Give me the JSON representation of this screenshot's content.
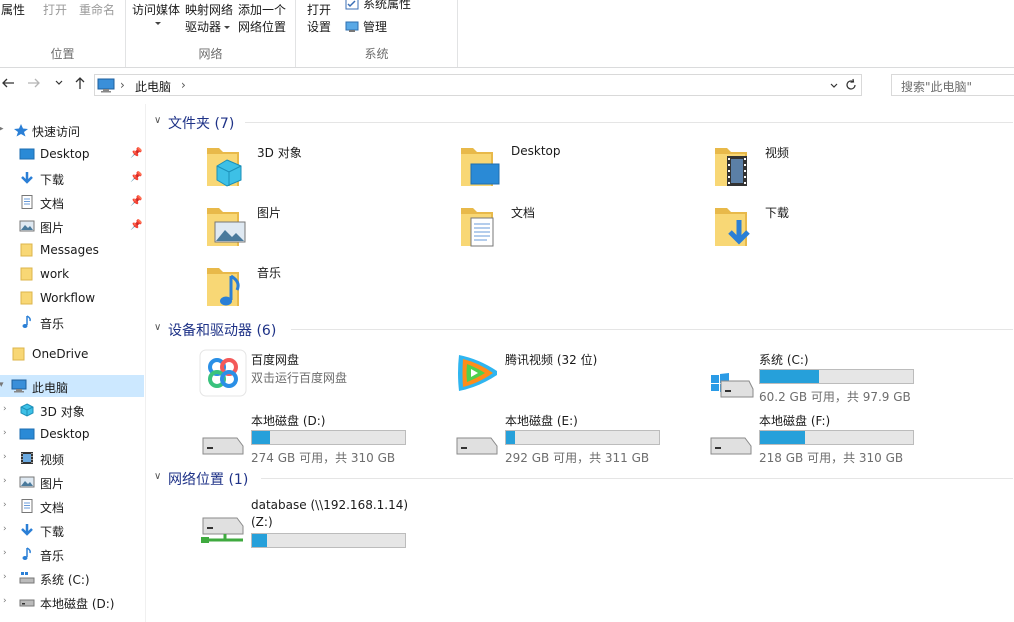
{
  "ribbon": {
    "groups": [
      {
        "label": "位置",
        "buttons": [
          "属性",
          "打开",
          "重命名"
        ]
      },
      {
        "label": "网络",
        "buttons": [
          "访问媒体",
          "映射网络",
          "驱动器",
          "添加一个",
          "网络位置"
        ]
      },
      {
        "label": "系统",
        "buttons": [
          "打开",
          "设置",
          "系统属性",
          "管理"
        ]
      }
    ]
  },
  "address": {
    "crumb": "此电脑",
    "search_placeholder": "搜索\"此电脑\""
  },
  "nav": {
    "quick_access": "快速访问",
    "items": [
      {
        "label": "Desktop",
        "icon": "desktop-icon",
        "pinned": true
      },
      {
        "label": "下载",
        "icon": "download-icon",
        "pinned": true
      },
      {
        "label": "文档",
        "icon": "document-icon",
        "pinned": true
      },
      {
        "label": "图片",
        "icon": "picture-icon",
        "pinned": true
      },
      {
        "label": "Messages",
        "icon": "folder-icon"
      },
      {
        "label": "work",
        "icon": "folder-icon"
      },
      {
        "label": "Workflow",
        "icon": "folder-icon"
      },
      {
        "label": "音乐",
        "icon": "music-icon"
      }
    ],
    "onedrive": "OneDrive",
    "this_pc": "此电脑",
    "pc_items": [
      {
        "label": "3D 对象",
        "icon": "3d-objects-icon"
      },
      {
        "label": "Desktop",
        "icon": "desktop-icon"
      },
      {
        "label": "视频",
        "icon": "video-icon"
      },
      {
        "label": "图片",
        "icon": "picture-icon"
      },
      {
        "label": "文档",
        "icon": "document-icon"
      },
      {
        "label": "下载",
        "icon": "download-icon"
      },
      {
        "label": "音乐",
        "icon": "music-icon"
      },
      {
        "label": "系统 (C:)",
        "icon": "drive-icon"
      },
      {
        "label": "本地磁盘 (D:)",
        "icon": "drive-icon"
      }
    ]
  },
  "sections": {
    "folders": {
      "title": "文件夹 (7)",
      "items": [
        {
          "name": "3D 对象",
          "icon": "3d-objects-folder-icon"
        },
        {
          "name": "Desktop",
          "icon": "desktop-folder-icon"
        },
        {
          "name": "视频",
          "icon": "video-folder-icon"
        },
        {
          "name": "图片",
          "icon": "picture-folder-icon"
        },
        {
          "name": "文档",
          "icon": "document-folder-icon"
        },
        {
          "name": "下载",
          "icon": "download-folder-icon"
        },
        {
          "name": "音乐",
          "icon": "music-folder-icon"
        }
      ]
    },
    "devices": {
      "title": "设备和驱动器 (6)",
      "apps": [
        {
          "name": "百度网盘",
          "sub": "双击运行百度网盘",
          "icon": "baidu-netdisk-icon"
        },
        {
          "name": "腾讯视频 (32 位)",
          "icon": "tencent-video-icon"
        }
      ],
      "drives": [
        {
          "name": "系统 (C:)",
          "free": "60.2 GB 可用，共 97.9 GB",
          "used_fraction": 0.385,
          "icon": "windows-drive-icon"
        },
        {
          "name": "本地磁盘 (D:)",
          "free": "274 GB 可用，共 310 GB",
          "used_fraction": 0.116,
          "icon": "hard-drive-icon"
        },
        {
          "name": "本地磁盘 (E:)",
          "free": "292 GB 可用，共 311 GB",
          "used_fraction": 0.061,
          "icon": "hard-drive-icon"
        },
        {
          "name": "本地磁盘 (F:)",
          "free": "218 GB 可用，共 310 GB",
          "used_fraction": 0.297,
          "icon": "hard-drive-icon"
        }
      ]
    },
    "network": {
      "title": "网络位置 (1)",
      "items": [
        {
          "name": "database (\\\\192.168.1.14)",
          "name2": "(Z:)",
          "used_fraction": 0.1,
          "icon": "network-drive-icon"
        }
      ]
    }
  },
  "colors": {
    "accent": "#26a0da",
    "section_title": "#1e3287",
    "selection": "#cce8ff",
    "folder": "#f8d775"
  }
}
